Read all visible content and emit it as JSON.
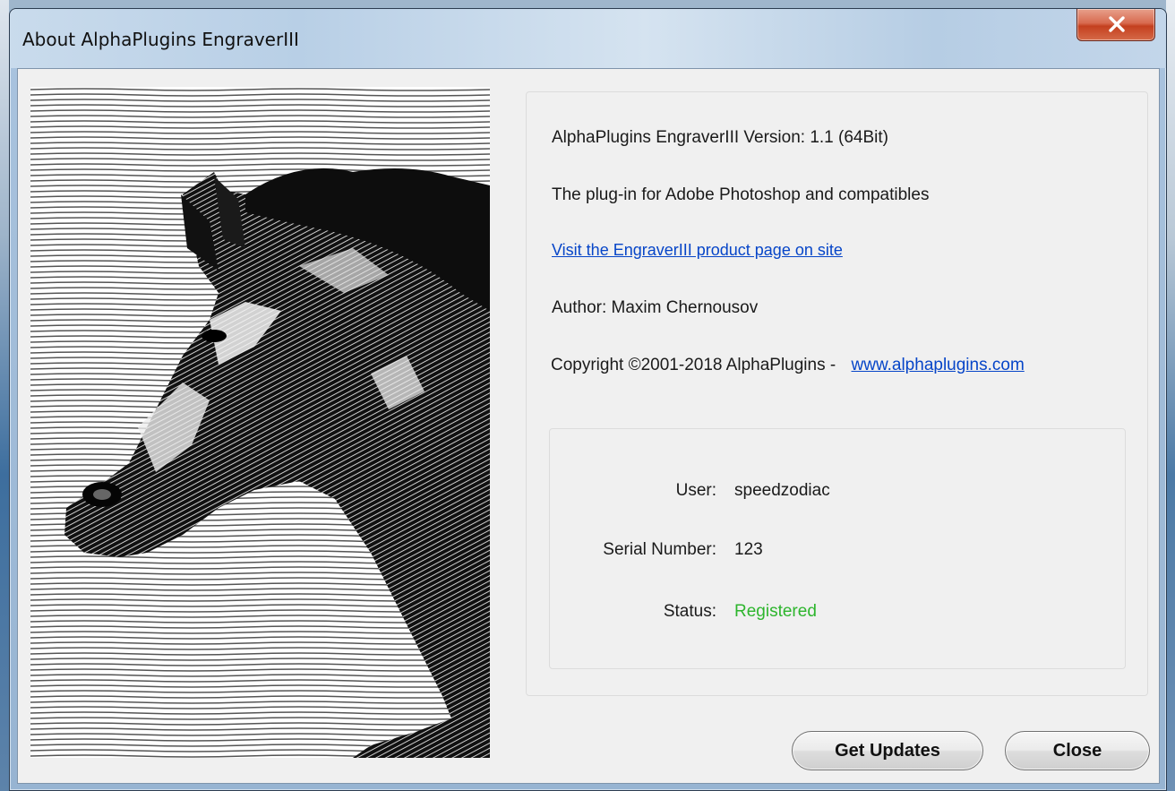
{
  "window": {
    "title": "About AlphaPlugins EngraverIII"
  },
  "info": {
    "version_line": "AlphaPlugins EngraverIII Version:  1.1 (64Bit)",
    "description": "The plug-in for Adobe Photoshop and compatibles",
    "product_link": "Visit the EngraverIII product page on site",
    "author": "Author: Maxim Chernousov",
    "copyright": "Copyright ©2001-2018 AlphaPlugins -",
    "site_link": "www.alphaplugins.com"
  },
  "registration": {
    "user_label": "User:",
    "user_value": "speedzodiac",
    "serial_label": "Serial Number:",
    "serial_value": "123",
    "status_label": "Status:",
    "status_value": "Registered"
  },
  "buttons": {
    "get_updates": "Get Updates",
    "close": "Close"
  },
  "colors": {
    "link": "#0645c8",
    "status_registered": "#2db52d",
    "close_button_red": "#c4401f"
  }
}
